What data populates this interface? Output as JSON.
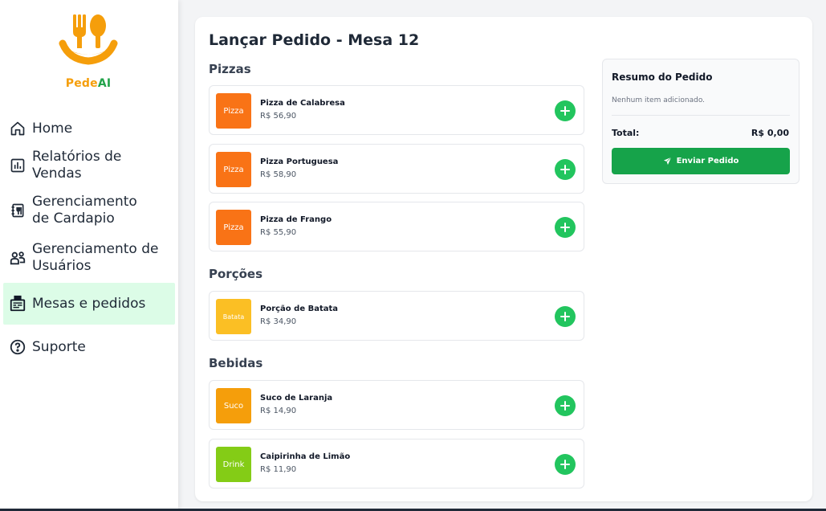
{
  "brand": {
    "name_part1": "Pede",
    "name_part2": "AI",
    "primary_color": "#f59e0b",
    "accent_color": "#22a34a"
  },
  "sidebar": {
    "items": [
      {
        "label": "Home",
        "icon": "home-icon"
      },
      {
        "label": "Relatórios de Vendas",
        "line1": "Relatórios de",
        "line2": "Vendas",
        "icon": "bar-chart-icon"
      },
      {
        "label": "Gerenciamento de Cardapio",
        "line1": "Gerenciamento",
        "line2": "de Cardapio",
        "icon": "menu-book-icon"
      },
      {
        "label": "Gerenciamento de Usuários",
        "line1": "Gerenciamento de",
        "line2": "Usuários",
        "icon": "users-icon"
      },
      {
        "label": "Mesas e pedidos",
        "icon": "cash-register-icon",
        "active": true
      },
      {
        "label": "Suporte",
        "icon": "help-icon"
      }
    ]
  },
  "main": {
    "title": "Lançar Pedido - Mesa 12",
    "sections": [
      {
        "title": "Pizzas",
        "items": [
          {
            "thumb": "Pizza",
            "thumb_color": "#f97316",
            "name": "Pizza de Calabresa",
            "price": "R$ 56,90"
          },
          {
            "thumb": "Pizza",
            "thumb_color": "#f97316",
            "name": "Pizza Portuguesa",
            "price": "R$ 58,90"
          },
          {
            "thumb": "Pizza",
            "thumb_color": "#f97316",
            "name": "Pizza de Frango",
            "price": "R$ 55,90"
          }
        ]
      },
      {
        "title": "Porções",
        "items": [
          {
            "thumb": "Batata",
            "thumb_color": "#fbbf24",
            "name": "Porção de Batata",
            "price": "R$ 34,90"
          }
        ]
      },
      {
        "title": "Bebidas",
        "items": [
          {
            "thumb": "Suco",
            "thumb_color": "#f59e0b",
            "name": "Suco de Laranja",
            "price": "R$ 14,90"
          },
          {
            "thumb": "Drink",
            "thumb_color": "#84cc16",
            "name": "Caipirinha de Limão",
            "price": "R$ 11,90"
          }
        ]
      }
    ]
  },
  "summary": {
    "title": "Resumo do Pedido",
    "empty_text": "Nenhum item adicionado.",
    "total_label": "Total:",
    "total_value": "R$ 0,00",
    "send_label": "Enviar Pedido",
    "send_color": "#16a34a"
  },
  "colors": {
    "add_button": "#22c55e",
    "active_nav_bg": "#dcfce7"
  }
}
